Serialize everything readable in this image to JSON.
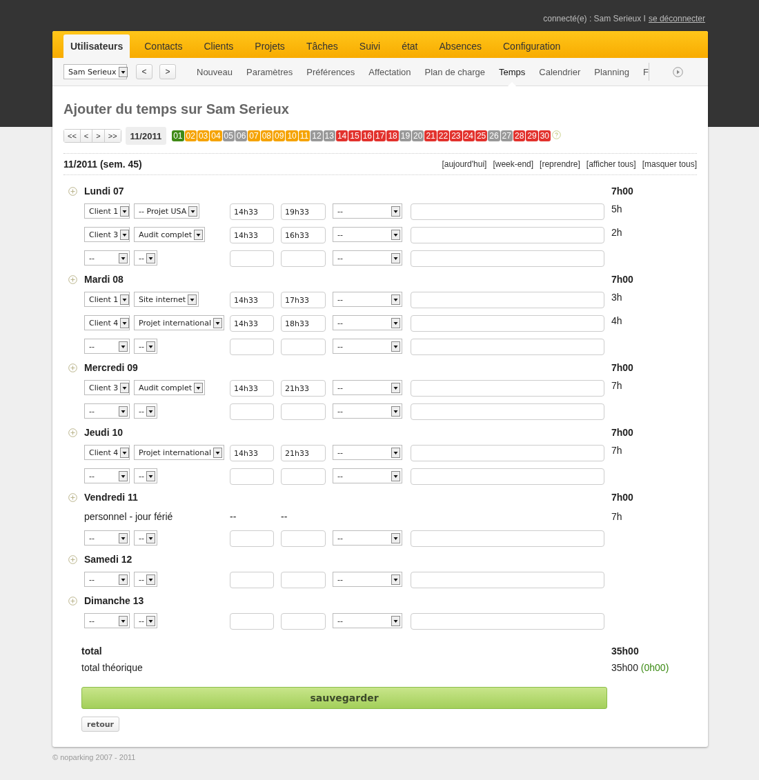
{
  "header": {
    "user_status": "connecté(e) : Sam Serieux I",
    "logout_link": "se déconnecter"
  },
  "main_tabs": [
    {
      "label": "Utilisateurs",
      "selected": true
    },
    {
      "label": "Contacts",
      "selected": false
    },
    {
      "label": "Clients",
      "selected": false
    },
    {
      "label": "Projets",
      "selected": false
    },
    {
      "label": "Tâches",
      "selected": false
    },
    {
      "label": "Suivi",
      "selected": false
    },
    {
      "label": "état",
      "selected": false
    },
    {
      "label": "Absences",
      "selected": false
    },
    {
      "label": "Configuration",
      "selected": false
    }
  ],
  "sub_toolbar": {
    "user_select": "Sam Serieux",
    "prev": "<",
    "next": ">"
  },
  "sub_tabs": [
    {
      "label": "Nouveau",
      "selected": false
    },
    {
      "label": "Paramètres",
      "selected": false
    },
    {
      "label": "Préférences",
      "selected": false
    },
    {
      "label": "Affectation",
      "selected": false
    },
    {
      "label": "Plan de charge",
      "selected": false
    },
    {
      "label": "Temps",
      "selected": true
    },
    {
      "label": "Calendrier",
      "selected": false
    },
    {
      "label": "Planning",
      "selected": false
    },
    {
      "label": "F",
      "selected": false
    }
  ],
  "page_title": "Ajouter du temps sur Sam Serieux",
  "week_nav": {
    "buttons": [
      "<<",
      "<",
      ">",
      ">>"
    ],
    "month": "11/2011",
    "days": [
      {
        "label": "01",
        "color": "#3f8a16"
      },
      {
        "label": "02",
        "color": "#f5a300"
      },
      {
        "label": "03",
        "color": "#f5a300"
      },
      {
        "label": "04",
        "color": "#f5a300"
      },
      {
        "label": "05",
        "color": "#999999"
      },
      {
        "label": "06",
        "color": "#999999"
      },
      {
        "label": "07",
        "color": "#f5a300"
      },
      {
        "label": "08",
        "color": "#f5a300"
      },
      {
        "label": "09",
        "color": "#f5a300"
      },
      {
        "label": "10",
        "color": "#f5a300"
      },
      {
        "label": "11",
        "color": "#f5a300"
      },
      {
        "label": "12",
        "color": "#999999"
      },
      {
        "label": "13",
        "color": "#999999"
      },
      {
        "label": "14",
        "color": "#e2322d"
      },
      {
        "label": "15",
        "color": "#e2322d"
      },
      {
        "label": "16",
        "color": "#e2322d"
      },
      {
        "label": "17",
        "color": "#e2322d"
      },
      {
        "label": "18",
        "color": "#e2322d"
      },
      {
        "label": "19",
        "color": "#999999"
      },
      {
        "label": "20",
        "color": "#999999"
      },
      {
        "label": "21",
        "color": "#e2322d"
      },
      {
        "label": "22",
        "color": "#e2322d"
      },
      {
        "label": "23",
        "color": "#e2322d"
      },
      {
        "label": "24",
        "color": "#e2322d"
      },
      {
        "label": "25",
        "color": "#e2322d"
      },
      {
        "label": "26",
        "color": "#999999"
      },
      {
        "label": "27",
        "color": "#999999"
      },
      {
        "label": "28",
        "color": "#e2322d"
      },
      {
        "label": "29",
        "color": "#e2322d"
      },
      {
        "label": "30",
        "color": "#e2322d"
      }
    ]
  },
  "period": {
    "title": "11/2011 (sem. 45)",
    "links": [
      "[aujourd'hui]",
      "[week-end]",
      "[reprendre]",
      "[afficher tous]",
      "[masquer tous]"
    ]
  },
  "days": [
    {
      "title": "Lundi 07",
      "total": "7h00",
      "rows": [
        {
          "kind": "entry",
          "client": "Client 1",
          "project": "-- Projet USA",
          "start": "14h33",
          "end": "19h33",
          "type": "--",
          "hours": "5h"
        },
        {
          "kind": "entry",
          "client": "Client 3",
          "project": "Audit complet",
          "start": "14h33",
          "end": "16h33",
          "type": "--",
          "hours": "2h"
        },
        {
          "kind": "blank",
          "client": "--",
          "project": "--",
          "type": "--"
        }
      ]
    },
    {
      "title": "Mardi 08",
      "total": "7h00",
      "rows": [
        {
          "kind": "entry",
          "client": "Client 1",
          "project": "Site internet",
          "start": "14h33",
          "end": "17h33",
          "type": "--",
          "hours": "3h"
        },
        {
          "kind": "entry",
          "client": "Client 4",
          "project": "Projet international",
          "start": "14h33",
          "end": "18h33",
          "type": "--",
          "hours": "4h"
        },
        {
          "kind": "blank",
          "client": "--",
          "project": "--",
          "type": "--"
        }
      ]
    },
    {
      "title": "Mercredi 09",
      "total": "7h00",
      "rows": [
        {
          "kind": "entry",
          "client": "Client 3",
          "project": "Audit complet",
          "start": "14h33",
          "end": "21h33",
          "type": "--",
          "hours": "7h"
        },
        {
          "kind": "blank",
          "client": "--",
          "project": "--",
          "type": "--"
        }
      ]
    },
    {
      "title": "Jeudi 10",
      "total": "7h00",
      "rows": [
        {
          "kind": "entry",
          "client": "Client 4",
          "project": "Projet international",
          "start": "14h33",
          "end": "21h33",
          "type": "--",
          "hours": "7h"
        },
        {
          "kind": "blank",
          "client": "--",
          "project": "--",
          "type": "--"
        }
      ]
    },
    {
      "title": "Vendredi 11",
      "total": "7h00",
      "rows": [
        {
          "kind": "absence",
          "label": "personnel - jour férié",
          "start": "--",
          "end": "--",
          "hours": "7h"
        },
        {
          "kind": "blank",
          "client": "--",
          "project": "--",
          "type": "--"
        }
      ]
    },
    {
      "title": "Samedi 12",
      "rows": [
        {
          "kind": "blank",
          "client": "--",
          "project": "--",
          "type": "--"
        }
      ]
    },
    {
      "title": "Dimanche 13",
      "rows": [
        {
          "kind": "blank",
          "client": "--",
          "project": "--",
          "type": "--"
        }
      ]
    }
  ],
  "totals": {
    "label": "total",
    "value": "35h00",
    "theoretical_label": "total théorique",
    "theoretical_value": "35h00",
    "difference": "(0h00)"
  },
  "buttons": {
    "save": "sauvegarder",
    "back": "retour"
  },
  "footer": "© noparking 2007 - 2011"
}
